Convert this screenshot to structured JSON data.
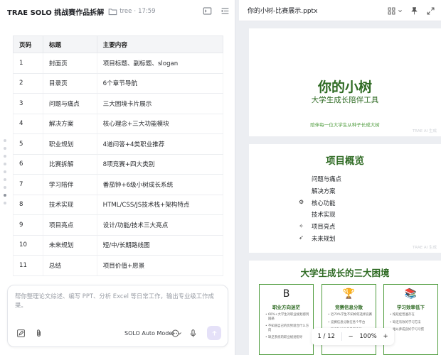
{
  "left_header": {
    "title": "TRAE SOLO 挑战赛作品拆解",
    "folder_name": "tree",
    "time": "17:59"
  },
  "table": {
    "headers": [
      "页码",
      "标题",
      "主要内容"
    ],
    "rows": [
      [
        "1",
        "封面页",
        "项目标题、副标题、slogan"
      ],
      [
        "2",
        "目录页",
        "6个章节导航"
      ],
      [
        "3",
        "问题与痛点",
        "三大困境卡片展示"
      ],
      [
        "4",
        "解决方案",
        "核心理念+三大功能模块"
      ],
      [
        "5",
        "职业规划",
        "4道问答+4类职业推荐"
      ],
      [
        "6",
        "比赛拆解",
        "8项竞赛+四大类别"
      ],
      [
        "7",
        "学习陪伴",
        "番茄钟+6级小树成长系统"
      ],
      [
        "8",
        "技术实现",
        "HTML/CSS/JS技术栈+架构特点"
      ],
      [
        "9",
        "项目亮点",
        "设计/功能/技术三大亮点"
      ],
      [
        "10",
        "未来规划",
        "短/中/长期路线图"
      ],
      [
        "11",
        "总结",
        "项目价值+愿景"
      ]
    ]
  },
  "input": {
    "placeholder": "帮你整理论文综述、编写 PPT、分析 Excel 等日常工作，输出专业级工作成果。",
    "model_label": "SOLO Auto Model"
  },
  "preview": {
    "file_name": "你的小树-比赛展示.pptx",
    "watermark": "TRAE AI 生成",
    "slide1": {
      "title": "你的小树",
      "subtitle": "大学生成长陪伴工具",
      "slogan": "陪伴每一位大学生从种子长成大树"
    },
    "slide2": {
      "title": "项目概览",
      "items": [
        "问题与痛点",
        "解决方案",
        "核心功能",
        "技术实现",
        "项目亮点",
        "未来规划"
      ]
    },
    "slide3": {
      "title": "大学生成长的三大困境",
      "cards": [
        {
          "icon": "B",
          "title": "职业方向迷茫",
          "points": [
            "60%+大学生对职业规划感到困惑",
            "不知道自己的优势适合什么方向",
            "缺乏系统的职业规划指导"
          ]
        },
        {
          "icon": "🏆",
          "title": "竞赛信息分散",
          "points": [
            "近70%学生不知如何选择竞赛",
            "竞赛信息分散在各个平台",
            "缺乏针对性的参赛指导"
          ]
        },
        {
          "icon": "📚",
          "title": "学习效率低下",
          "points": [
            "拖延症普遍存在",
            "缺乏有效的学习方法",
            "难以养成良好学习习惯"
          ]
        }
      ]
    },
    "pager": {
      "page_indicator": "1 / 12",
      "zoom_minus": "−",
      "zoom_level": "100%",
      "zoom_plus": "+"
    }
  },
  "colors": {
    "accent_green": "#2f6b24",
    "light_green": "#4f9c3e",
    "send_button_bg": "#e5e1f8"
  }
}
